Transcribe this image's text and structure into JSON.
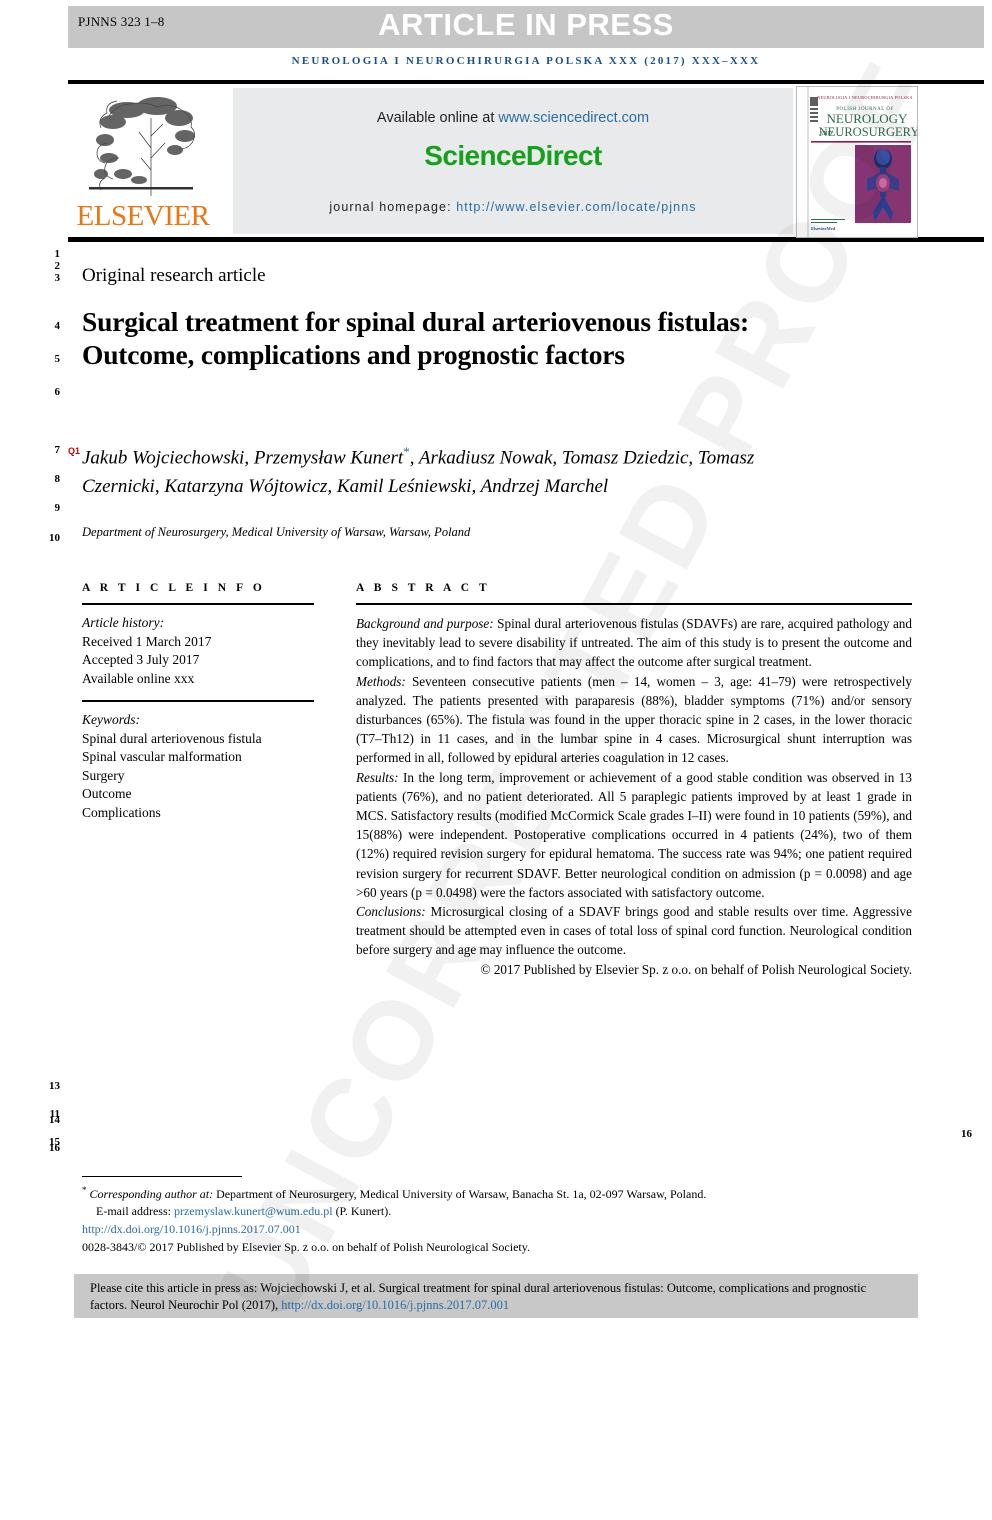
{
  "header": {
    "article_code": "PJNNS 323 1–8",
    "press_banner": "ARTICLE IN PRESS",
    "journal_line": "NEUROLOGIA I NEUROCHIRURGIA POLSKA XXX (2017) XXX–XXX"
  },
  "masthead": {
    "publisher_name": "ELSEVIER",
    "available_prefix": "Available online at ",
    "available_link": "www.sciencedirect.com",
    "brand": "ScienceDirect",
    "homepage_prefix": "journal homepage: ",
    "homepage_link": "http://www.elsevier.com/locate/pjnns",
    "cover": {
      "top_banner": "NEUROLOGIA I NEUROCHIRURGIA POLSKA",
      "line1": "POLISH JOURNAL OF",
      "line2": "NEUROLOGY",
      "line3_small": "AND",
      "line3": "NEUROSURGERY",
      "footer": "ElsevierMed"
    }
  },
  "article": {
    "kind": "Original research article",
    "title": "Surgical treatment for spinal dural arteriovenous fistulas: Outcome, complications and prognostic factors",
    "query_marker": "Q1",
    "authors": "Jakub Wojciechowski, Przemysław Kunert",
    "authors_rest": ", Arkadiusz Nowak, Tomasz Dziedzic, Tomasz Czernicki, Katarzyna Wójtowicz, Kamil Leśniewski, Andrzej Marchel",
    "corresponding_star": "*",
    "affiliation": "Department of Neurosurgery, Medical University of Warsaw, Warsaw, Poland"
  },
  "article_info": {
    "heading": "A R T I C L E   I N F O",
    "history_label": "Article history:",
    "received": "Received 1 March 2017",
    "accepted": "Accepted 3 July 2017",
    "available_online": "Available online xxx",
    "keywords_label": "Keywords:",
    "keywords": [
      "Spinal dural arteriovenous fistula",
      "Spinal vascular malformation",
      "Surgery",
      "Outcome",
      "Complications"
    ]
  },
  "abstract": {
    "heading": "A B S T R A C T",
    "sections": [
      {
        "label": "Background and purpose:",
        "text": " Spinal dural arteriovenous fistulas (SDAVFs) are rare, acquired pathology and they inevitably lead to severe disability if untreated. The aim of this study is to present the outcome and complications, and to find factors that may affect the outcome after surgical treatment."
      },
      {
        "label": "Methods:",
        "text": " Seventeen consecutive patients (men – 14, women – 3, age: 41–79) were retrospectively analyzed. The patients presented with paraparesis (88%), bladder symptoms (71%) and/or sensory disturbances (65%). The fistula was found in the upper thoracic spine in 2 cases, in the lower thoracic (T7–Th12) in 11 cases, and in the lumbar spine in 4 cases. Microsurgical shunt interruption was performed in all, followed by epidural arteries coagulation in 12 cases."
      },
      {
        "label": "Results:",
        "text": " In the long term, improvement or achievement of a good stable condition was observed in 13 patients (76%), and no patient deteriorated. All 5 paraplegic patients improved by at least 1 grade in MCS. Satisfactory results (modified McCormick Scale grades I–II) were found in 10 patients (59%), and 15(88%) were independent. Postoperative complications occurred in 4 patients (24%), two of them (12%) required revision surgery for epidural hematoma. The success rate was 94%; one patient required revision surgery for recurrent SDAVF. Better neurological condition on admission (p = 0.0098) and age >60 years (p = 0.0498) were the factors associated with satisfactory outcome."
      },
      {
        "label": "Conclusions:",
        "text": " Microsurgical closing of a SDAVF brings good and stable results over time. Aggressive treatment should be attempted even in cases of total loss of spinal cord function. Neurological condition before surgery and age may influence the outcome."
      }
    ],
    "copyright": "© 2017 Published by Elsevier Sp. z o.o. on behalf of Polish Neurological Society."
  },
  "footnotes": {
    "corresponding_star": "*",
    "corresponding_label": "Corresponding author at:",
    "corresponding_text": " Department of Neurosurgery, Medical University of Warsaw, Banacha St. 1a, 02-097 Warsaw, Poland.",
    "email_label": "E-mail address:",
    "email": "przemyslaw.kunert@wum.edu.pl",
    "email_suffix": " (P. Kunert).",
    "doi": "http://dx.doi.org/10.1016/j.pjnns.2017.07.001",
    "issn_line": "0028-3843/© 2017 Published by Elsevier Sp. z o.o. on behalf of Polish Neurological Society."
  },
  "citation_box": {
    "text": "Please cite this article in press as: Wojciechowski J, et al. Surgical treatment for spinal dural arteriovenous fistulas: Outcome, complications and prognostic factors. Neurol Neurochir Pol (2017), ",
    "link": "http://dx.doi.org/10.1016/j.pjnns.2017.07.001"
  },
  "watermark": "UNCORRECTED PROOF",
  "line_numbers": {
    "left": [
      "1",
      "2",
      "3",
      "4",
      "5",
      "6",
      "7",
      "8",
      "9",
      "10",
      "13",
      "11",
      "14",
      "15",
      "16"
    ],
    "right": "16"
  },
  "colors": {
    "link": "#2b6ca3",
    "brand_green": "#17a01c",
    "elsevier_orange": "#E87613",
    "banner_gray": "#c6c6c6",
    "query_red": "#cc0000"
  }
}
